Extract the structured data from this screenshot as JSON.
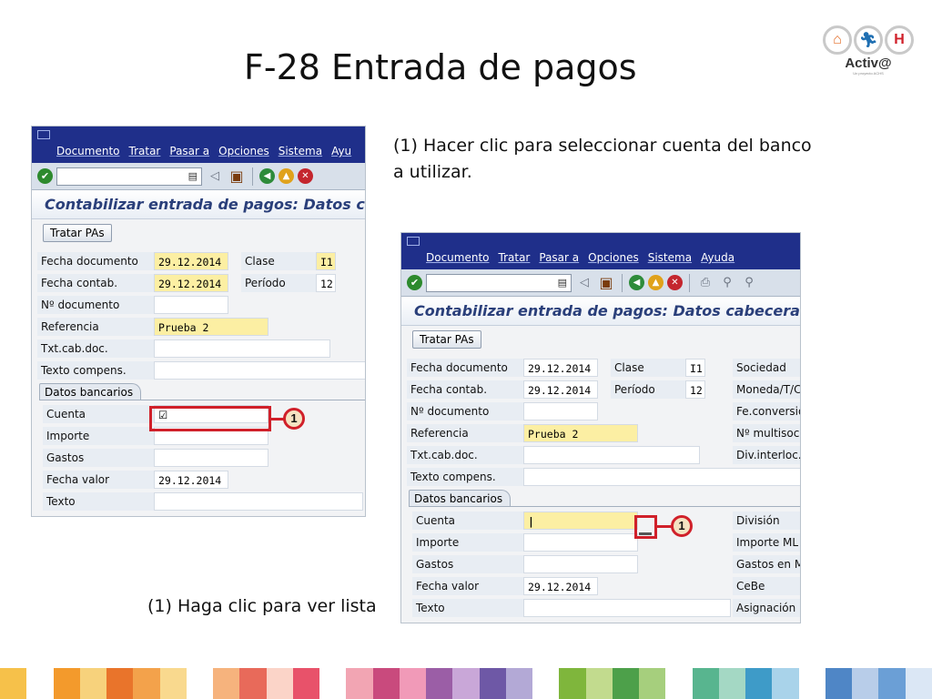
{
  "slide": {
    "title": "F-28 Entrada de pagos",
    "caption_top": "(1) Hacer clic para seleccionar cuenta del banco a utilizar.",
    "caption_bottom": "(1) Haga clic para ver lista"
  },
  "logo": {
    "name": "Activ@",
    "sub": "Un proyecto ACHS"
  },
  "sap_menu": [
    "Documento",
    "Tratar",
    "Pasar a",
    "Opciones",
    "Sistema",
    "Ayuda"
  ],
  "sap_menu_left_visible": [
    "Documento",
    "Tratar",
    "Pasar a",
    "Opciones",
    "Sistema",
    "Ayu"
  ],
  "screen_title": "Contabilizar entrada de pagos: Datos cabecera",
  "screen_title_left": "Contabilizar entrada de pagos: Datos c",
  "button_tratar": "Tratar PAs",
  "header_fields": {
    "fecha_documento": {
      "label": "Fecha documento",
      "value": "29.12.2014"
    },
    "fecha_contab": {
      "label": "Fecha contab.",
      "value": "29.12.2014"
    },
    "n_documento": {
      "label": "Nº documento",
      "value": ""
    },
    "referencia": {
      "label": "Referencia",
      "value": "Prueba 2"
    },
    "txt_cab_doc": {
      "label": "Txt.cab.doc.",
      "value": ""
    },
    "texto_compens": {
      "label": "Texto compens.",
      "value": ""
    },
    "clase": {
      "label": "Clase",
      "value": "I1"
    },
    "periodo": {
      "label": "Período",
      "value": "12"
    }
  },
  "right_labels": {
    "sociedad": "Sociedad",
    "moneda": "Moneda/T/C",
    "fe_conversion": "Fe.conversió",
    "multisoc": "Nº multisoc.",
    "div_interloc": "Div.interloc."
  },
  "bank_group": {
    "title": "Datos bancarios",
    "cuenta": {
      "label": "Cuenta",
      "value": ""
    },
    "importe": {
      "label": "Importe",
      "value": ""
    },
    "gastos": {
      "label": "Gastos",
      "value": ""
    },
    "fecha_valor": {
      "label": "Fecha valor",
      "value": "29.12.2014"
    },
    "texto": {
      "label": "Texto",
      "value": ""
    }
  },
  "bank_right_labels": {
    "division": "División",
    "importe_ml": "Importe ML",
    "gastos_en": "Gastos en M",
    "cebe": "CeBe",
    "asignacion": "Asignación"
  },
  "step_number": "1",
  "colors": {
    "menubar": "#1f2f8a",
    "required_field": "#fcefa3",
    "callout": "#d0202a"
  },
  "stripe_colors": [
    "#f6c14a",
    "#ffffff",
    "#f39a2c",
    "#f7d27c",
    "#e9742b",
    "#f3a24b",
    "#f9d98e",
    "#ffffff",
    "#f6b37d",
    "#e86a5a",
    "#fbd4c8",
    "#e8526a",
    "#ffffff",
    "#f2a5b3",
    "#c94a7d",
    "#f19ab8",
    "#9b5ea6",
    "#c9a7d8",
    "#6e58a6",
    "#b3a9d6",
    "#ffffff",
    "#7fb63c",
    "#c2db8e",
    "#4da04a",
    "#a6cf7d",
    "#ffffff",
    "#58b58f",
    "#a4d8c4",
    "#3e9bc8",
    "#a9d3ea",
    "#ffffff",
    "#4f86c6",
    "#b8cde9",
    "#6b9fd6",
    "#dbe7f5"
  ]
}
